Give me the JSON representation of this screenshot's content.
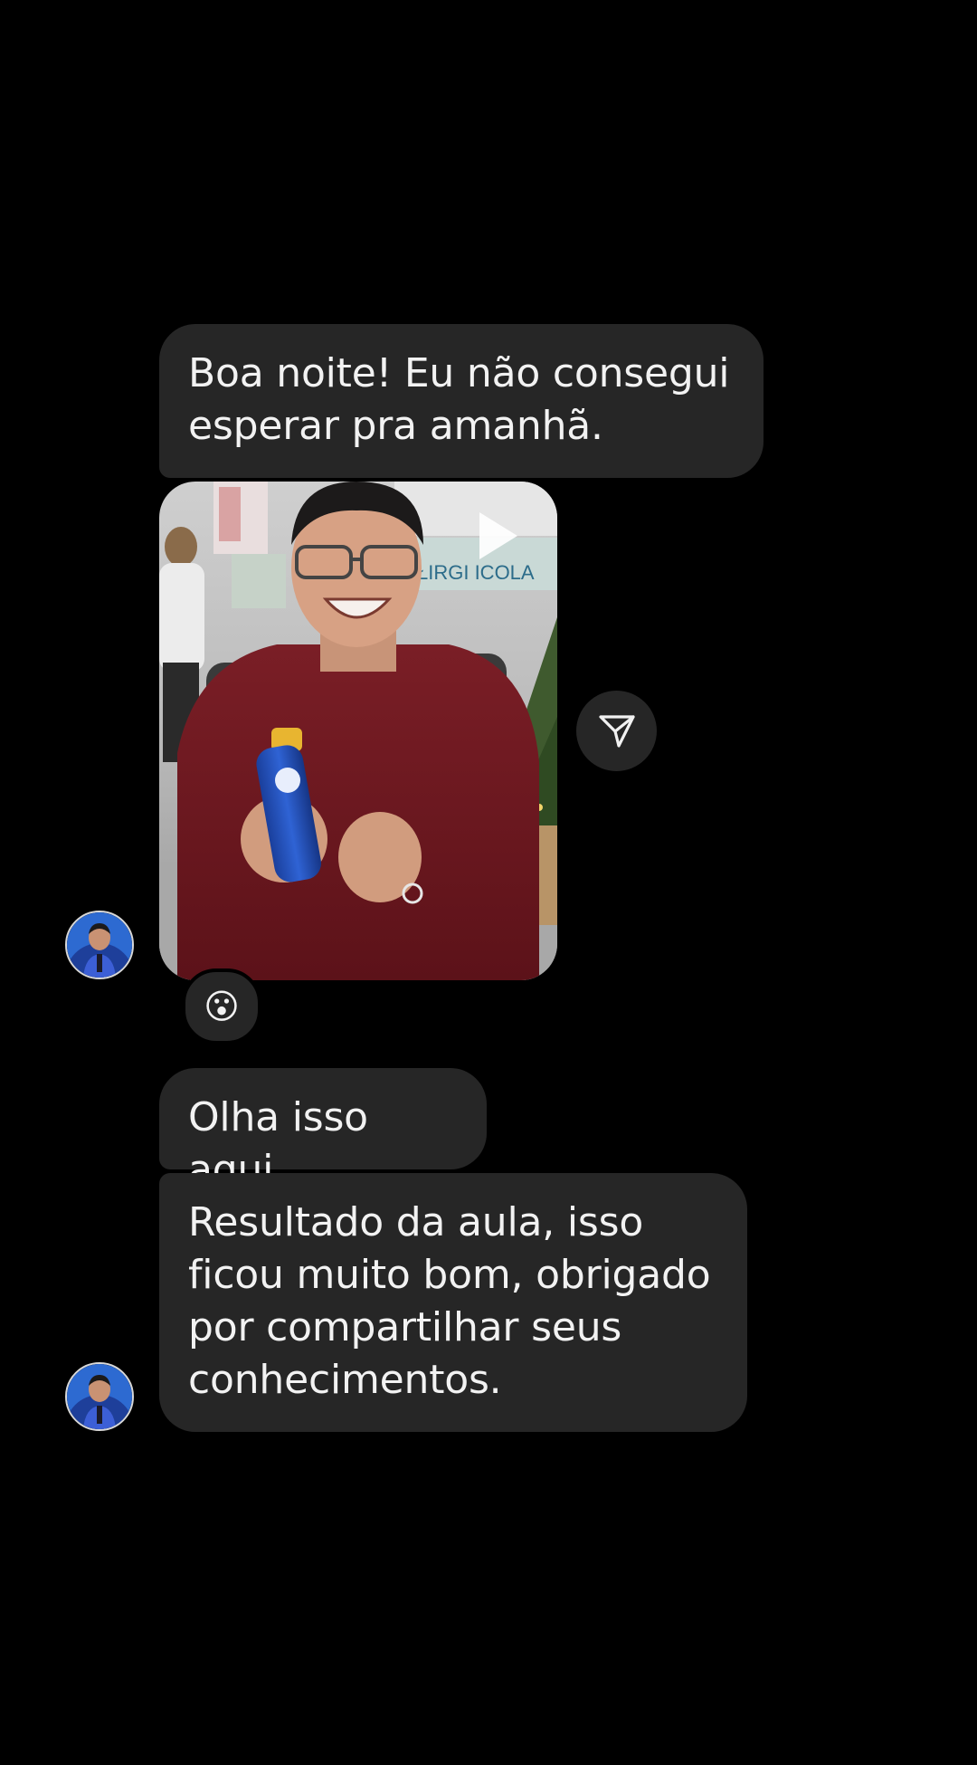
{
  "thread": {
    "messages": [
      {
        "type": "text",
        "text": "Boa noite! Eu não consegui\nesperar pra amanhã."
      },
      {
        "type": "video",
        "icon": "play-icon",
        "share_icon": "send-icon",
        "reaction": "😮"
      },
      {
        "type": "text",
        "text": "Olha isso aqui"
      },
      {
        "type": "text",
        "text": "Resultado da aula, isso\nficou muito bom, obrigado\npor compartilhar seus\nconhecimentos."
      }
    ]
  },
  "colors": {
    "background": "#000000",
    "bubble": "#262626",
    "text": "#f2f2f2"
  }
}
